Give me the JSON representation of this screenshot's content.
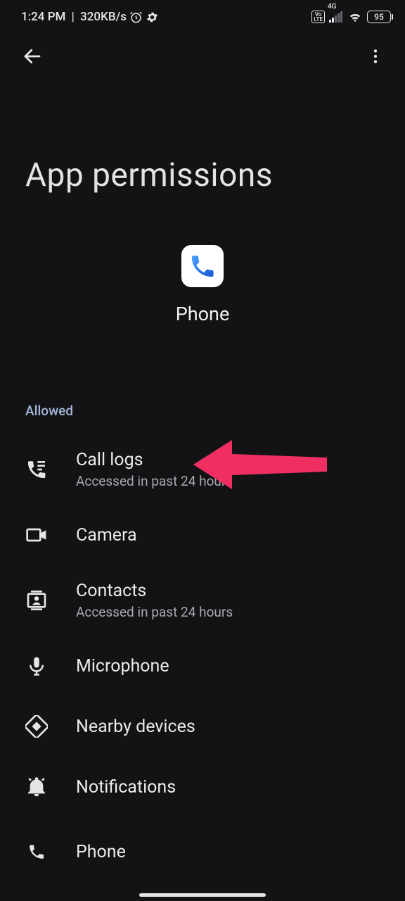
{
  "status_bar": {
    "time": "1:24 PM",
    "speed": "320KB/s",
    "battery": "95",
    "network_label": "4G",
    "volte": "Vo LTE"
  },
  "header": {
    "title": "App permissions"
  },
  "app": {
    "name": "Phone"
  },
  "sections": {
    "allowed_label": "Allowed"
  },
  "permissions": [
    {
      "title": "Call logs",
      "subtitle": "Accessed in past 24 hours",
      "icon": "call-log-icon"
    },
    {
      "title": "Camera",
      "subtitle": "",
      "icon": "camera-icon"
    },
    {
      "title": "Contacts",
      "subtitle": "Accessed in past 24 hours",
      "icon": "contacts-icon"
    },
    {
      "title": "Microphone",
      "subtitle": "",
      "icon": "microphone-icon"
    },
    {
      "title": "Nearby devices",
      "subtitle": "",
      "icon": "nearby-icon"
    },
    {
      "title": "Notifications",
      "subtitle": "",
      "icon": "notifications-icon"
    },
    {
      "title": "Phone",
      "subtitle": "",
      "icon": "phone-perm-icon"
    }
  ]
}
